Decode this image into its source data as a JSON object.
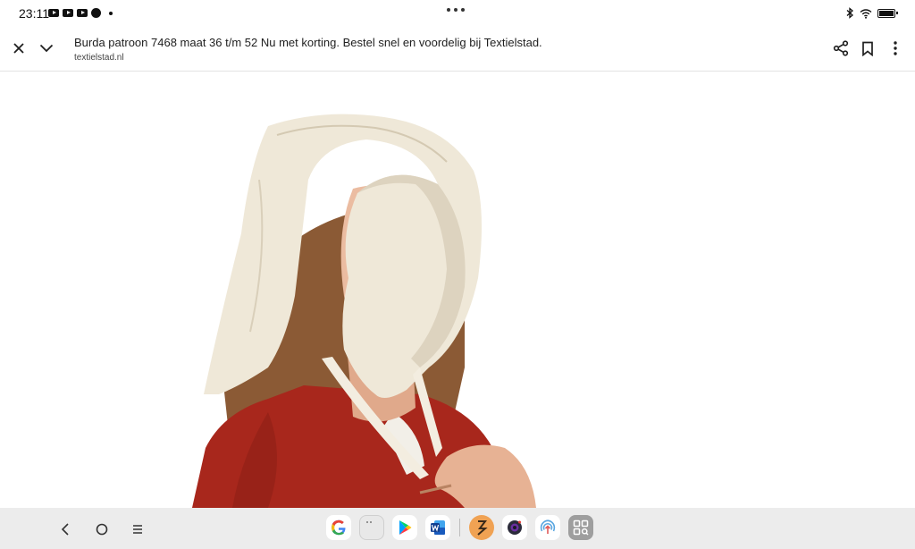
{
  "status_bar": {
    "time": "23:11",
    "notification_icons": [
      "youtube-icon",
      "youtube-icon",
      "youtube-icon",
      "app-icon"
    ],
    "system_icons": [
      "bluetooth-icon",
      "wifi-icon",
      "battery-icon"
    ]
  },
  "tab": {
    "title": "Burda patroon 7468 maat 36 t/m 52 Nu met korting. Bestel snel en voordelig bij Textielstad.",
    "domain": "textielstad.nl",
    "actions": [
      "share-icon",
      "bookmark-icon",
      "more-icon"
    ]
  },
  "content": {
    "image_subject": "woman wearing white cloth bonnet and red dress"
  },
  "nav_bar": {
    "buttons": [
      "back",
      "home",
      "recents"
    ],
    "dock_apps": [
      "Google",
      "App drawer",
      "Play Store",
      "Word",
      "Zap",
      "Camera",
      "Podcasts",
      "Apps grid"
    ]
  },
  "colors": {
    "dress_red": "#a8271c",
    "bonnet_cream": "#efe8d8",
    "nav_bg": "#ececec",
    "skin": "#e8b79c"
  }
}
